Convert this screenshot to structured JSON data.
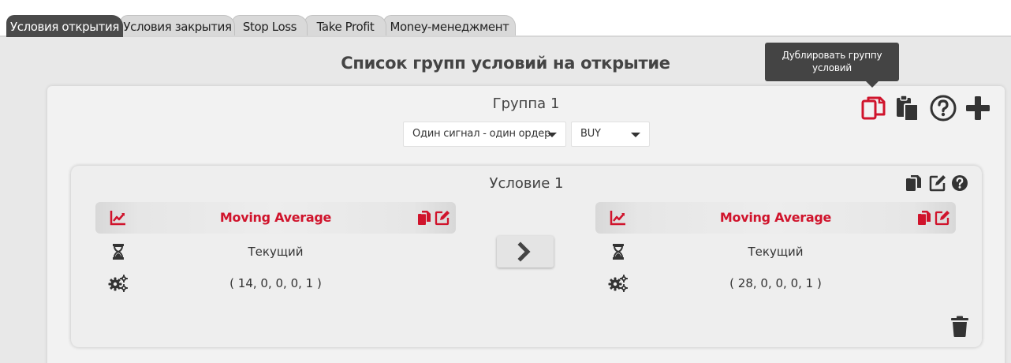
{
  "tabs": [
    {
      "label": "Условия открытия",
      "active": true
    },
    {
      "label": "Условия закрытия",
      "active": false
    },
    {
      "label": "Stop Loss",
      "active": false
    },
    {
      "label": "Take Profit",
      "active": false
    },
    {
      "label": "Money-менеджмент",
      "active": false
    }
  ],
  "page_title": "Список групп условий на открытие",
  "tooltip": {
    "line1": "Дублировать группу",
    "line2": "условий"
  },
  "group": {
    "title": "Группа 1",
    "mode_select": {
      "value": "Один сигнал - один ордер"
    },
    "side_select": {
      "value": "BUY"
    },
    "actions": [
      "duplicate-group-icon",
      "paste-icon",
      "help-icon",
      "add-icon"
    ]
  },
  "condition": {
    "title": "Условие 1",
    "actions": [
      "copy-icon",
      "edit-icon",
      "help-icon"
    ],
    "left": {
      "indicator": "Moving Average",
      "timeframe": "Текущий",
      "params": "( 14, 0, 0, 0, 1 )"
    },
    "right": {
      "indicator": "Moving Average",
      "timeframe": "Текущий",
      "params": "( 28, 0, 0, 0, 1 )"
    },
    "operator_icon": "chevron-right-icon"
  },
  "colors": {
    "accent": "#d0142c",
    "tab_active": "#4a4a4a",
    "icon_dark": "#333333"
  }
}
